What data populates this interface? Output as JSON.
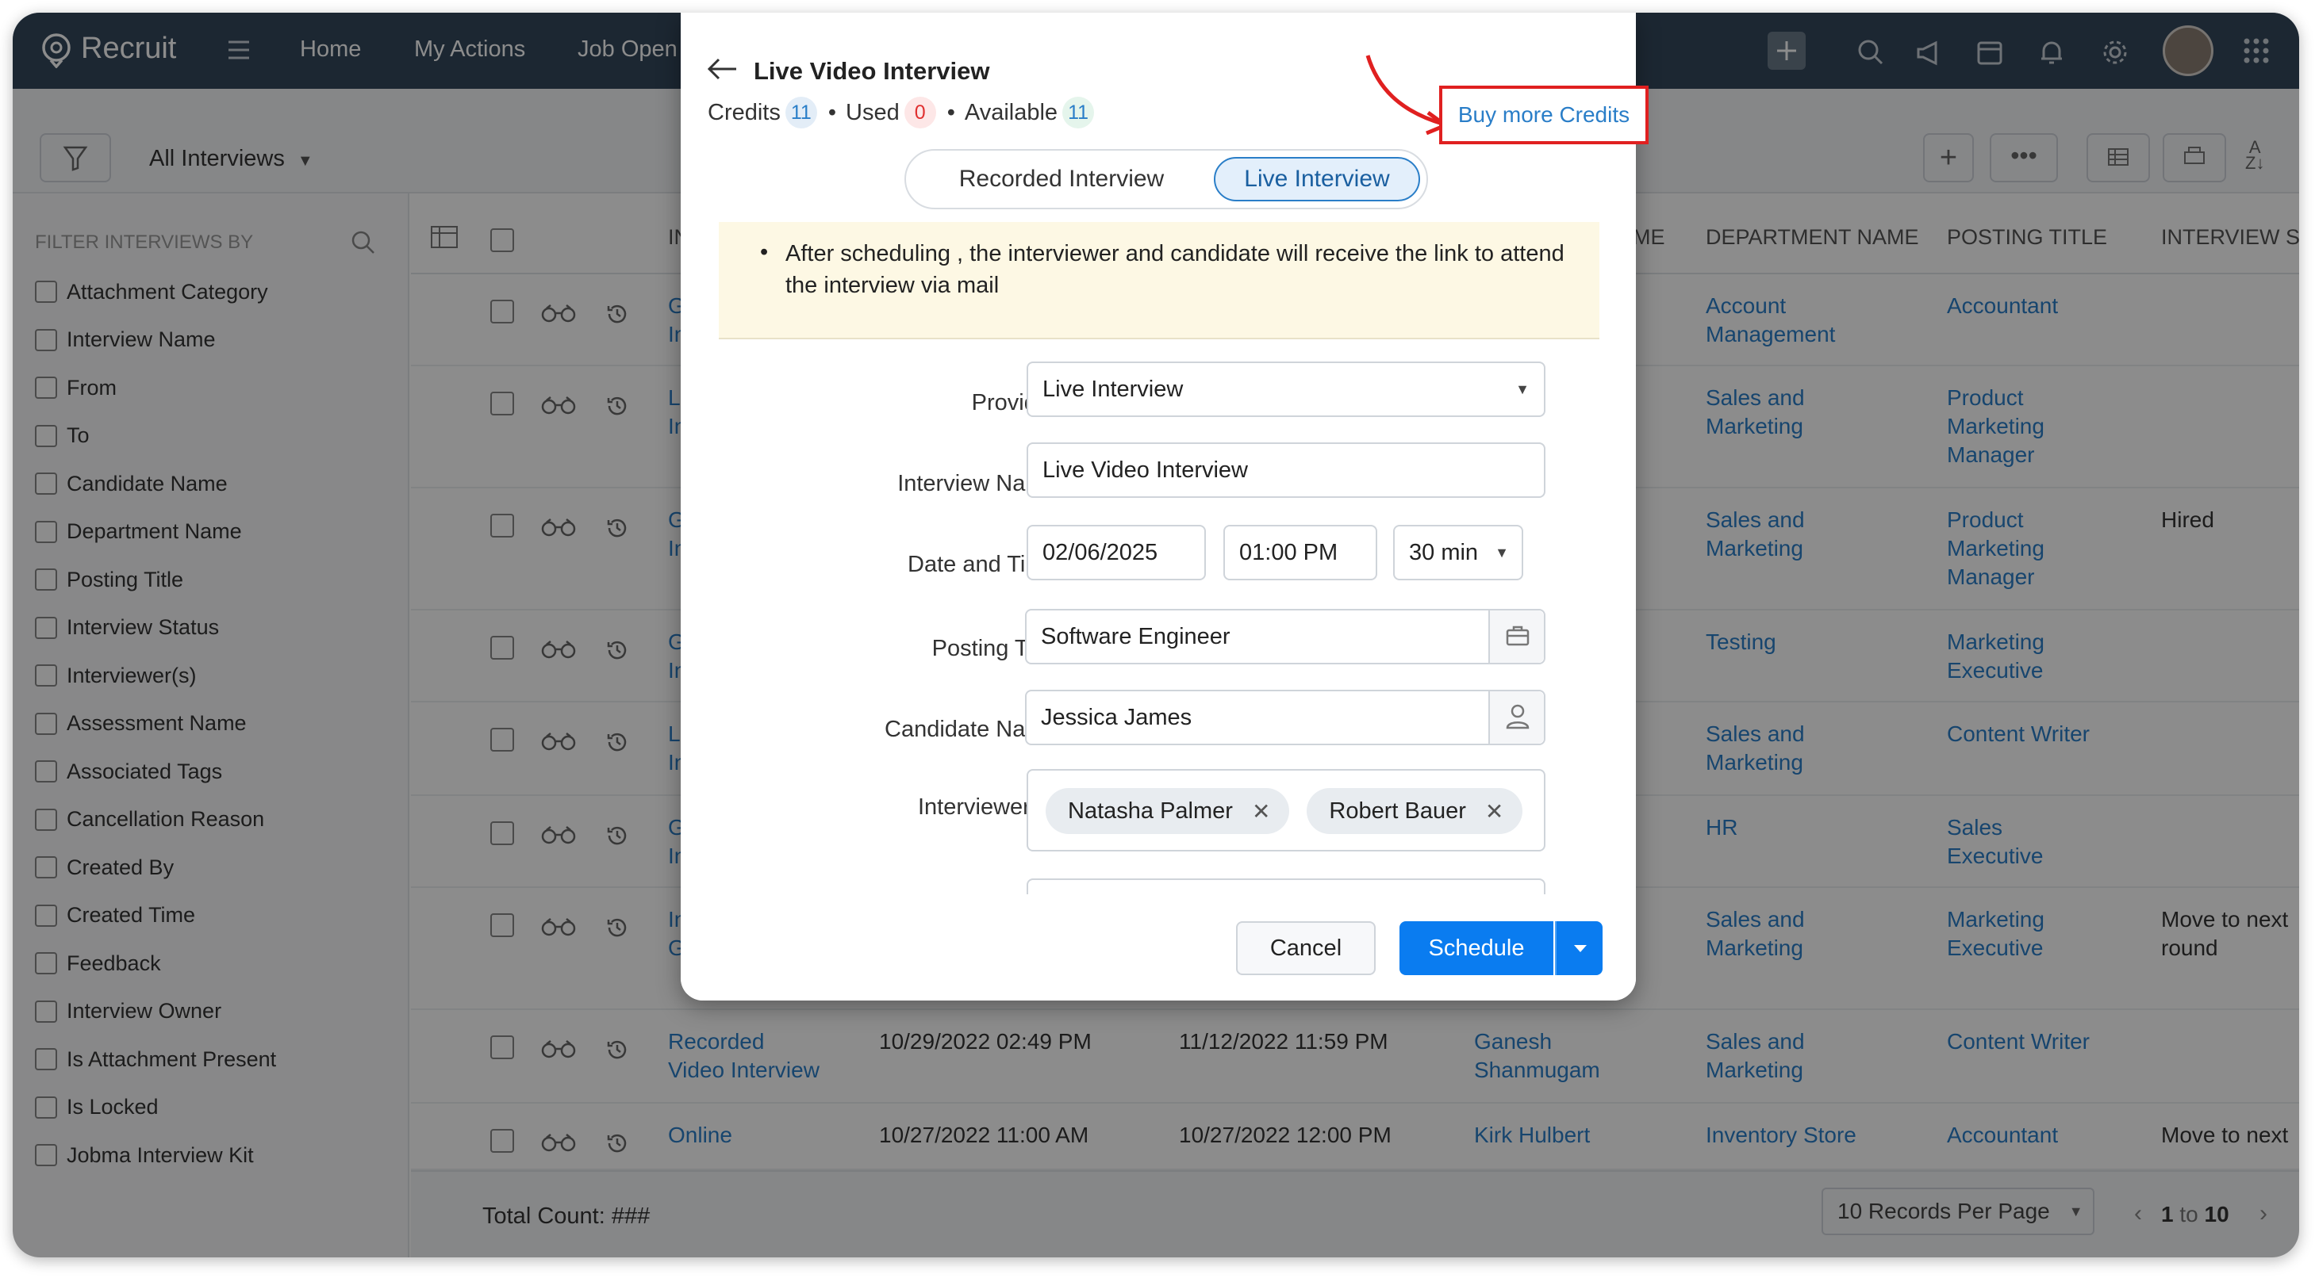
{
  "app": {
    "name": "Recruit"
  },
  "nav": {
    "home": "Home",
    "my_actions": "My Actions",
    "job_openings": "Job Open"
  },
  "toolbar": {
    "view_label": "All Interviews"
  },
  "sidebar": {
    "filter_title": "FILTER INTERVIEWS BY",
    "items": [
      "Attachment Category",
      "Interview Name",
      "From",
      "To",
      "Candidate Name",
      "Department Name",
      "Posting Title",
      "Interview Status",
      "Interviewer(s)",
      "Assessment Name",
      "Associated Tags",
      "Cancellation Reason",
      "Created By",
      "Created Time",
      "Feedback",
      "Interview Owner",
      "Is Attachment Present",
      "Is Locked",
      "Jobma Interview Kit"
    ]
  },
  "grid": {
    "headers": {
      "c1": "INT",
      "c_me": "ME",
      "department": "DEPARTMENT NAME",
      "posting": "POSTING TITLE",
      "status": "INTERVIEW STA"
    },
    "rows": [
      {
        "name1": "Ge",
        "name2": "Int",
        "dept1": "Account",
        "dept2": "Management",
        "post1": "Accountant",
        "post2": "",
        "post3": "",
        "status1": "",
        "status2": ""
      },
      {
        "name1": "Liv",
        "name2": "Int",
        "dept1": "Sales and",
        "dept2": "Marketing",
        "post1": "Product",
        "post2": "Marketing",
        "post3": "Manager",
        "status1": "",
        "status2": ""
      },
      {
        "name1": "Ge",
        "name2": "Int",
        "dept1": "Sales and",
        "dept2": "Marketing",
        "post1": "Product",
        "post2": "Marketing",
        "post3": "Manager",
        "status1": "Hired",
        "status2": ""
      },
      {
        "name1": "Ge",
        "name2": "Int",
        "dept1": "Testing",
        "dept2": "",
        "post1": "Marketing",
        "post2": "Executive",
        "post3": "",
        "status1": "",
        "status2": ""
      },
      {
        "name1": "Liv",
        "name2": "Int",
        "dept1": "Sales and",
        "dept2": "Marketing",
        "post1": "Content Writer",
        "post2": "",
        "post3": "",
        "status1": "",
        "status2": ""
      },
      {
        "name1": "Ge",
        "name2": "Int",
        "dept1": "HR",
        "dept2": "",
        "post1": "Sales",
        "post2": "Executive",
        "post3": "",
        "status1": "",
        "status2": ""
      },
      {
        "name1": "Int",
        "name2": "Go",
        "dept1": "Sales and",
        "dept2": "Marketing",
        "post1": "Marketing",
        "post2": "Executive",
        "post3": "",
        "status1": "Move to next",
        "status2": "round"
      },
      {
        "name1": "Recorded",
        "name2": "Video Interview",
        "from": "10/29/2022 02:49 PM",
        "to": "11/12/2022 11:59 PM",
        "owner1": "Ganesh",
        "owner2": "Shanmugam",
        "dept1": "Sales and",
        "dept2": "Marketing",
        "post1": "Content Writer",
        "post2": "",
        "post3": "",
        "status1": "",
        "status2": ""
      },
      {
        "name1": "Online",
        "name2": "",
        "from": "10/27/2022 11:00 AM",
        "to": "10/27/2022 12:00 PM",
        "owner1": "Kirk Hulbert",
        "owner2": "",
        "dept1": "Inventory Store",
        "dept2": "",
        "post1": "Accountant",
        "post2": "",
        "post3": "",
        "status1": "Move to next",
        "status2": ""
      }
    ]
  },
  "footer": {
    "total": "Total Count: ###",
    "per_page": "10 Records Per Page",
    "range_a": "1",
    "range_to": "to",
    "range_b": "10"
  },
  "modal": {
    "title": "Live Video Interview",
    "credits_label": "Credits",
    "credits_value": "11",
    "used_label": "Used",
    "used_value": "0",
    "available_label": "Available",
    "available_value": "11",
    "buy_link": "Buy more Credits",
    "tab_recorded": "Recorded Interview",
    "tab_live": "Live Interview",
    "info": "After scheduling , the interviewer and candidate will receive the link to attend the interview via mail",
    "labels": {
      "provider": "Provider",
      "interview_name": "Interview Name",
      "date_time": "Date and Time",
      "posting_title": "Posting Title",
      "candidate_name": "Candidate Name",
      "interviewers": "Interviewer(s)"
    },
    "values": {
      "provider": "Live Interview",
      "interview_name": "Live Video Interview",
      "date": "02/06/2025",
      "time": "01:00 PM",
      "duration": "30 min",
      "posting_title": "Software Engineer",
      "candidate_name": "Jessica James"
    },
    "interviewers": [
      "Natasha Palmer",
      "Robert Bauer"
    ],
    "cancel": "Cancel",
    "schedule": "Schedule"
  },
  "colors": {
    "topbar": "#33475b",
    "link": "#2a7ec8",
    "primary": "#0a7cf0",
    "highlight": "#e02020"
  }
}
